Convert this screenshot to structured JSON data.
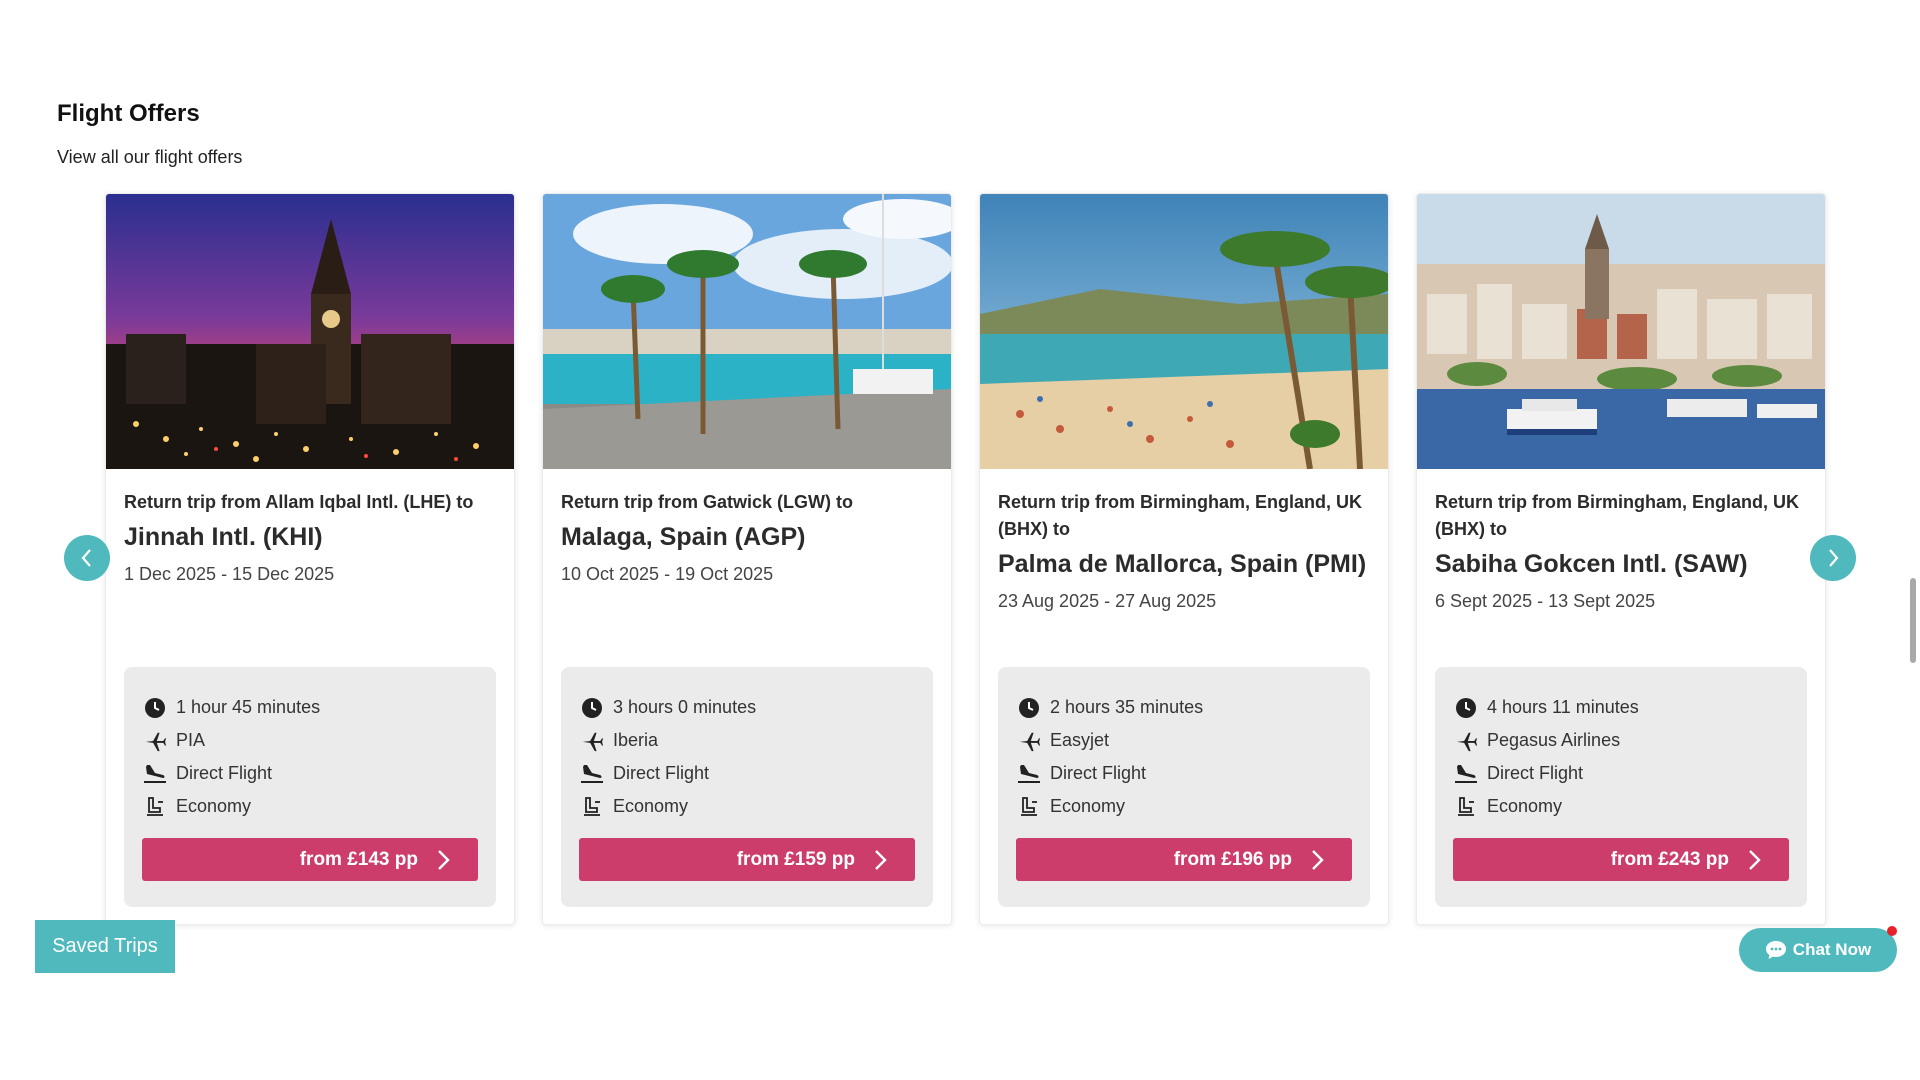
{
  "section": {
    "title": "Flight Offers",
    "subtitle": "View all our flight offers"
  },
  "cards": [
    {
      "image": "karachi-clock-tower-night",
      "from_text": "Return trip from Allam Iqbal Intl. (LHE) to",
      "destination": "Jinnah Intl. (KHI)",
      "dates": "1 Dec 2025 - 15 Dec 2025",
      "duration": "1 hour 45 minutes",
      "airline": "PIA",
      "flight_type": "Direct Flight",
      "cabin": "Economy",
      "price_label": "from £143 pp"
    },
    {
      "image": "malaga-palm-harbour",
      "from_text": "Return trip from Gatwick (LGW) to",
      "destination": "Malaga, Spain (AGP)",
      "dates": "10 Oct 2025 - 19 Oct 2025",
      "duration": "3 hours 0 minutes",
      "airline": "Iberia",
      "flight_type": "Direct Flight",
      "cabin": "Economy",
      "price_label": "from £159 pp"
    },
    {
      "image": "mallorca-beach",
      "from_text": "Return trip from Birmingham, England, UK (BHX) to",
      "destination": "Palma de Mallorca, Spain (PMI)",
      "dates": "23 Aug 2025 - 27 Aug 2025",
      "duration": "2 hours 35 minutes",
      "airline": "Easyjet",
      "flight_type": "Direct Flight",
      "cabin": "Economy",
      "price_label": "from £196 pp"
    },
    {
      "image": "istanbul-galata-waterfront",
      "from_text": "Return trip from Birmingham, England, UK (BHX) to",
      "destination": "Sabiha Gokcen Intl. (SAW)",
      "dates": "6 Sept 2025 - 13 Sept 2025",
      "duration": "4 hours 11 minutes",
      "airline": "Pegasus Airlines",
      "flight_type": "Direct Flight",
      "cabin": "Economy",
      "price_label": "from £243 pp"
    }
  ],
  "icons": {
    "prev": "chevron-left-icon",
    "next": "chevron-right-icon",
    "duration": "clock-icon",
    "airline": "plane-icon",
    "flight_type": "landing-icon",
    "cabin": "seat-icon"
  },
  "buttons": {
    "saved_trips": "Saved Trips",
    "chat_now": "Chat Now"
  },
  "colors": {
    "accent_teal": "#4fb9bd",
    "price_pink": "#cc3d6b",
    "info_bg": "#ebebeb",
    "notification_red": "#e8202a"
  }
}
